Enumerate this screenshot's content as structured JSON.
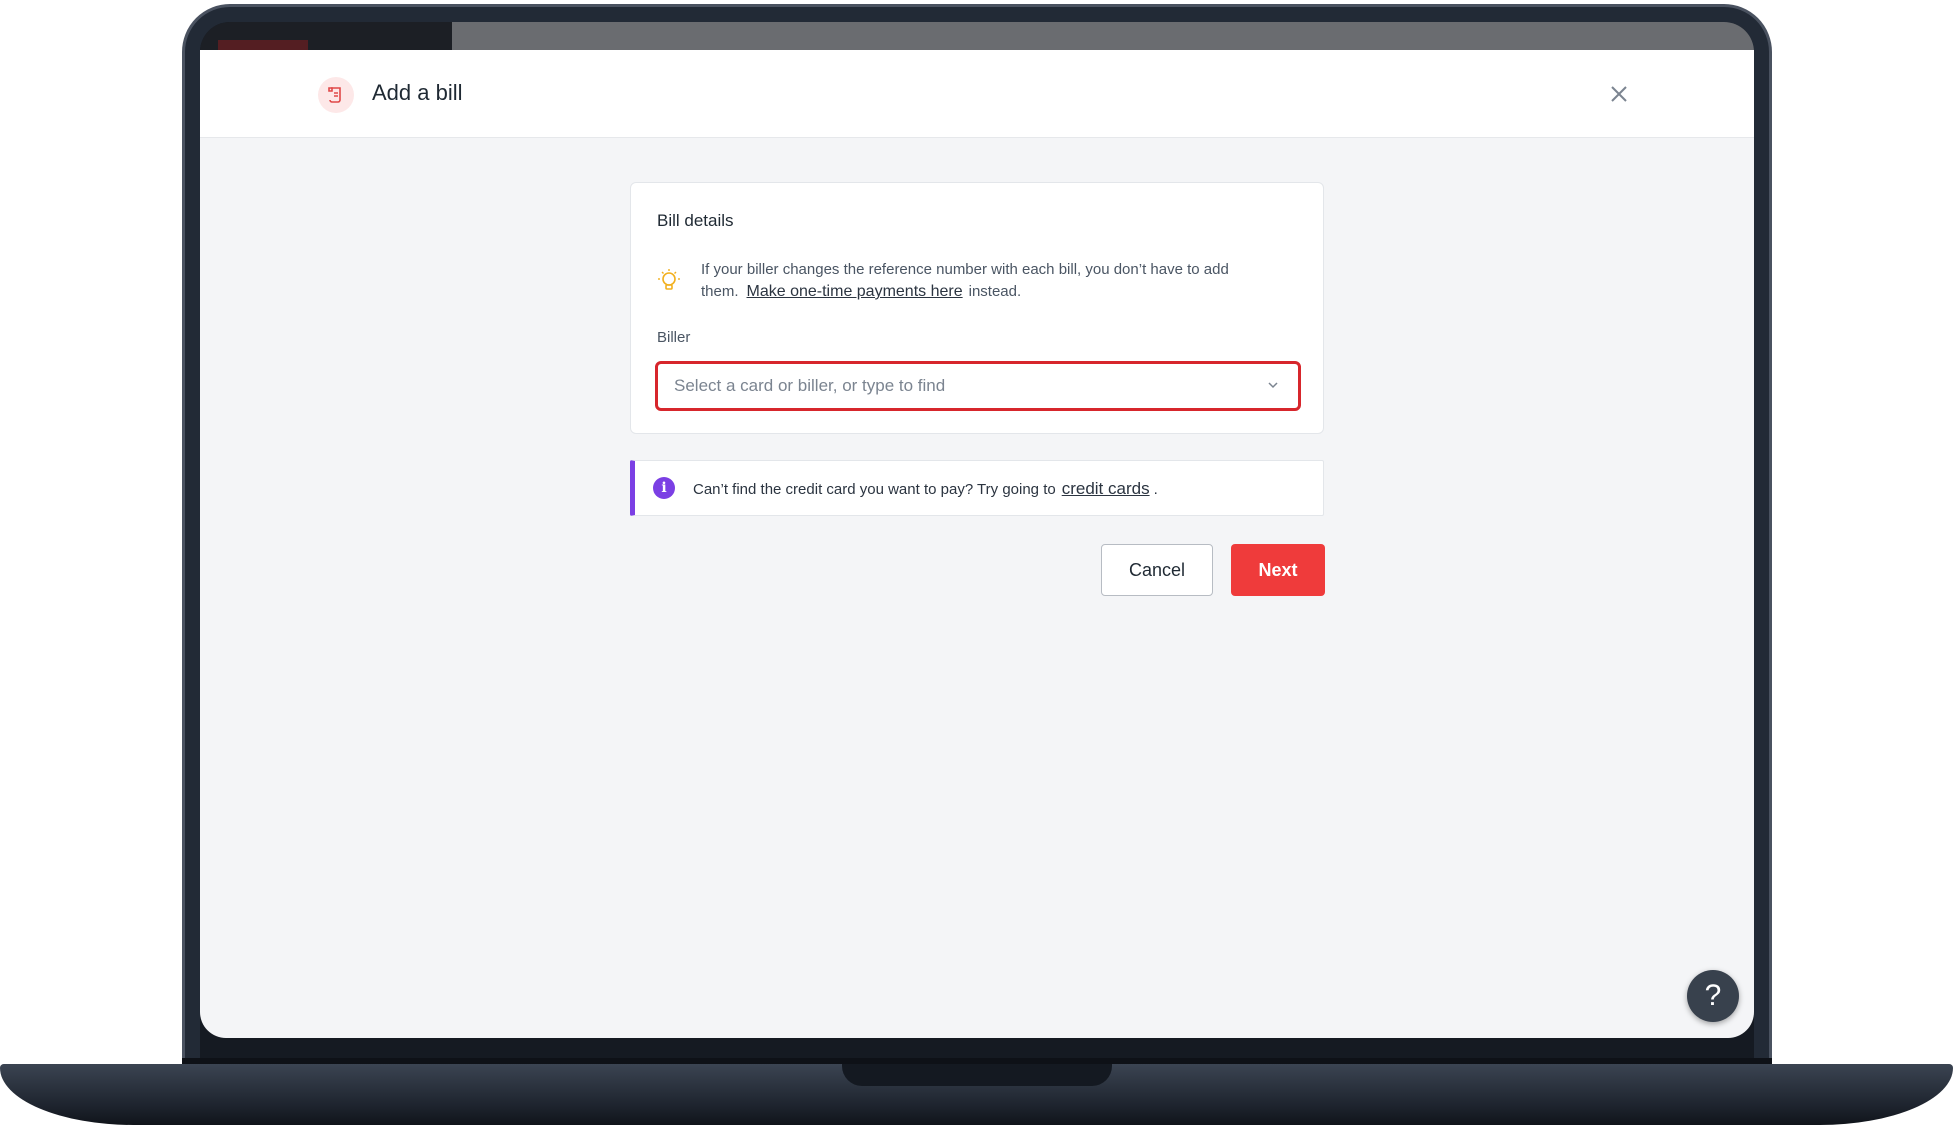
{
  "header": {
    "title": "Add a bill",
    "icon": "bill-icon",
    "close_icon": "close-icon"
  },
  "bill_details": {
    "title": "Bill details",
    "tip_icon": "lightbulb-icon",
    "tip_text_before": "If your biller changes the reference number with each bill, you don’t have to add them.",
    "tip_link": "Make one-time payments here",
    "tip_text_after": "instead.",
    "biller_label": "Biller",
    "biller_placeholder": "Select a card or biller, or type to find"
  },
  "info_banner": {
    "icon": "info-icon",
    "text": "Can’t find the credit card you want to pay? Try going to",
    "link": "credit cards",
    "suffix": "."
  },
  "actions": {
    "cancel_label": "Cancel",
    "next_label": "Next"
  },
  "help": {
    "label": "?"
  },
  "colors": {
    "accent_red": "#ef3b3b",
    "highlight_red": "#d7262c",
    "info_purple": "#7b3fe4"
  }
}
